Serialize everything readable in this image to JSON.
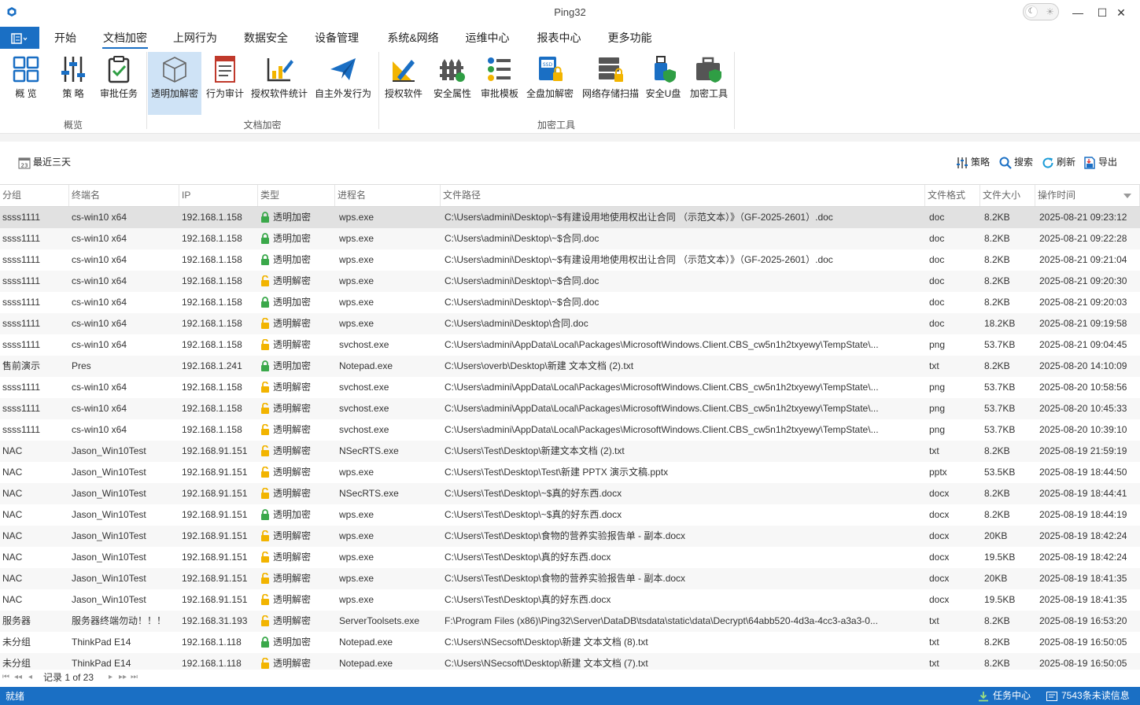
{
  "window": {
    "title": "Ping32",
    "theme_icons": {
      "moon": "☾",
      "sun": "☀"
    },
    "controls": {
      "minimize": "—",
      "maximize": "☐",
      "close": "✕"
    }
  },
  "app_menu_icon": "list-menu-icon",
  "menu_tabs": [
    "开始",
    "文档加密",
    "上网行为",
    "数据安全",
    "设备管理",
    "系统&网络",
    "运维中心",
    "报表中心",
    "更多功能"
  ],
  "active_tab": "文档加密",
  "ribbon": {
    "buttons": [
      {
        "label": "概 览",
        "icon": "dashboard-icon"
      },
      {
        "label": "策 略",
        "icon": "sliders-icon"
      },
      {
        "label": "审批任务",
        "icon": "clipboard-check-icon"
      },
      {
        "label": "透明加解密",
        "icon": "cube-icon",
        "active": true
      },
      {
        "label": "行为审计",
        "icon": "report-icon"
      },
      {
        "label": "授权软件统计",
        "icon": "chart-pen-icon"
      },
      {
        "label": "自主外发行为",
        "icon": "paper-plane-icon"
      },
      {
        "label": "授权软件",
        "icon": "pen-ruler-icon"
      },
      {
        "label": "安全属性",
        "icon": "fence-icon"
      },
      {
        "label": "审批模板",
        "icon": "template-list-icon"
      },
      {
        "label": "全盘加解密",
        "icon": "ssd-lock-icon"
      },
      {
        "label": "网络存储扫描",
        "icon": "server-lock-icon"
      },
      {
        "label": "安全U盘",
        "icon": "usb-shield-icon"
      },
      {
        "label": "加密工具",
        "icon": "toolbox-shield-icon"
      }
    ],
    "groups": [
      "概览",
      "文档加密",
      "加密工具"
    ]
  },
  "toolbar": {
    "date_filter": "最近三天",
    "date_icon_text": "23",
    "policy": "策略",
    "search": "搜索",
    "refresh": "刷新",
    "export": "导出"
  },
  "table": {
    "columns": [
      "分组",
      "终端名",
      "IP",
      "类型",
      "进程名",
      "文件路径",
      "文件格式",
      "文件大小",
      "操作时间"
    ],
    "sort_icon": "sort-desc-icon",
    "rows": [
      {
        "group": "ssss1111",
        "terminal": "cs-win10 x64",
        "ip": "192.168.1.158",
        "type": "透明加密",
        "lock": "green",
        "process": "wps.exe",
        "path": "C:\\Users\\admini\\Desktop\\~$有建设用地使用权出让合同 （示范文本）》（GF-2025-2601）.doc",
        "format": "doc",
        "size": "8.2KB",
        "time": "2025-08-21 09:23:12"
      },
      {
        "group": "ssss1111",
        "terminal": "cs-win10 x64",
        "ip": "192.168.1.158",
        "type": "透明加密",
        "lock": "green",
        "process": "wps.exe",
        "path": "C:\\Users\\admini\\Desktop\\~$合同.doc",
        "format": "doc",
        "size": "8.2KB",
        "time": "2025-08-21 09:22:28"
      },
      {
        "group": "ssss1111",
        "terminal": "cs-win10 x64",
        "ip": "192.168.1.158",
        "type": "透明加密",
        "lock": "green",
        "process": "wps.exe",
        "path": "C:\\Users\\admini\\Desktop\\~$有建设用地使用权出让合同 （示范文本）》（GF-2025-2601）.doc",
        "format": "doc",
        "size": "8.2KB",
        "time": "2025-08-21 09:21:04"
      },
      {
        "group": "ssss1111",
        "terminal": "cs-win10 x64",
        "ip": "192.168.1.158",
        "type": "透明解密",
        "lock": "yellow",
        "process": "wps.exe",
        "path": "C:\\Users\\admini\\Desktop\\~$合同.doc",
        "format": "doc",
        "size": "8.2KB",
        "time": "2025-08-21 09:20:30"
      },
      {
        "group": "ssss1111",
        "terminal": "cs-win10 x64",
        "ip": "192.168.1.158",
        "type": "透明加密",
        "lock": "green",
        "process": "wps.exe",
        "path": "C:\\Users\\admini\\Desktop\\~$合同.doc",
        "format": "doc",
        "size": "8.2KB",
        "time": "2025-08-21 09:20:03"
      },
      {
        "group": "ssss1111",
        "terminal": "cs-win10 x64",
        "ip": "192.168.1.158",
        "type": "透明解密",
        "lock": "yellow",
        "process": "wps.exe",
        "path": "C:\\Users\\admini\\Desktop\\合同.doc",
        "format": "doc",
        "size": "18.2KB",
        "time": "2025-08-21 09:19:58"
      },
      {
        "group": "ssss1111",
        "terminal": "cs-win10 x64",
        "ip": "192.168.1.158",
        "type": "透明解密",
        "lock": "yellow",
        "process": "svchost.exe",
        "path": "C:\\Users\\admini\\AppData\\Local\\Packages\\MicrosoftWindows.Client.CBS_cw5n1h2txyewy\\TempState\\...",
        "format": "png",
        "size": "53.7KB",
        "time": "2025-08-21 09:04:45"
      },
      {
        "group": "售前演示",
        "terminal": "Pres",
        "ip": "192.168.1.241",
        "type": "透明加密",
        "lock": "green",
        "process": "Notepad.exe",
        "path": "C:\\Users\\overb\\Desktop\\新建 文本文档 (2).txt",
        "format": "txt",
        "size": "8.2KB",
        "time": "2025-08-20 14:10:09"
      },
      {
        "group": "ssss1111",
        "terminal": "cs-win10 x64",
        "ip": "192.168.1.158",
        "type": "透明解密",
        "lock": "yellow",
        "process": "svchost.exe",
        "path": "C:\\Users\\admini\\AppData\\Local\\Packages\\MicrosoftWindows.Client.CBS_cw5n1h2txyewy\\TempState\\...",
        "format": "png",
        "size": "53.7KB",
        "time": "2025-08-20 10:58:56"
      },
      {
        "group": "ssss1111",
        "terminal": "cs-win10 x64",
        "ip": "192.168.1.158",
        "type": "透明解密",
        "lock": "yellow",
        "process": "svchost.exe",
        "path": "C:\\Users\\admini\\AppData\\Local\\Packages\\MicrosoftWindows.Client.CBS_cw5n1h2txyewy\\TempState\\...",
        "format": "png",
        "size": "53.7KB",
        "time": "2025-08-20 10:45:33"
      },
      {
        "group": "ssss1111",
        "terminal": "cs-win10 x64",
        "ip": "192.168.1.158",
        "type": "透明解密",
        "lock": "yellow",
        "process": "svchost.exe",
        "path": "C:\\Users\\admini\\AppData\\Local\\Packages\\MicrosoftWindows.Client.CBS_cw5n1h2txyewy\\TempState\\...",
        "format": "png",
        "size": "53.7KB",
        "time": "2025-08-20 10:39:10"
      },
      {
        "group": "NAC",
        "terminal": "Jason_Win10Test",
        "ip": "192.168.91.151",
        "type": "透明解密",
        "lock": "yellow",
        "process": "NSecRTS.exe",
        "path": "C:\\Users\\Test\\Desktop\\新建文本文档 (2).txt",
        "format": "txt",
        "size": "8.2KB",
        "time": "2025-08-19 21:59:19"
      },
      {
        "group": "NAC",
        "terminal": "Jason_Win10Test",
        "ip": "192.168.91.151",
        "type": "透明解密",
        "lock": "yellow",
        "process": "wps.exe",
        "path": "C:\\Users\\Test\\Desktop\\Test\\新建 PPTX 演示文稿.pptx",
        "format": "pptx",
        "size": "53.5KB",
        "time": "2025-08-19 18:44:50"
      },
      {
        "group": "NAC",
        "terminal": "Jason_Win10Test",
        "ip": "192.168.91.151",
        "type": "透明解密",
        "lock": "yellow",
        "process": "NSecRTS.exe",
        "path": "C:\\Users\\Test\\Desktop\\~$真的好东西.docx",
        "format": "docx",
        "size": "8.2KB",
        "time": "2025-08-19 18:44:41"
      },
      {
        "group": "NAC",
        "terminal": "Jason_Win10Test",
        "ip": "192.168.91.151",
        "type": "透明加密",
        "lock": "green",
        "process": "wps.exe",
        "path": "C:\\Users\\Test\\Desktop\\~$真的好东西.docx",
        "format": "docx",
        "size": "8.2KB",
        "time": "2025-08-19 18:44:19"
      },
      {
        "group": "NAC",
        "terminal": "Jason_Win10Test",
        "ip": "192.168.91.151",
        "type": "透明解密",
        "lock": "yellow",
        "process": "wps.exe",
        "path": "C:\\Users\\Test\\Desktop\\食物的营养实验报告单 - 副本.docx",
        "format": "docx",
        "size": "20KB",
        "time": "2025-08-19 18:42:24"
      },
      {
        "group": "NAC",
        "terminal": "Jason_Win10Test",
        "ip": "192.168.91.151",
        "type": "透明解密",
        "lock": "yellow",
        "process": "wps.exe",
        "path": "C:\\Users\\Test\\Desktop\\真的好东西.docx",
        "format": "docx",
        "size": "19.5KB",
        "time": "2025-08-19 18:42:24"
      },
      {
        "group": "NAC",
        "terminal": "Jason_Win10Test",
        "ip": "192.168.91.151",
        "type": "透明解密",
        "lock": "yellow",
        "process": "wps.exe",
        "path": "C:\\Users\\Test\\Desktop\\食物的营养实验报告单 - 副本.docx",
        "format": "docx",
        "size": "20KB",
        "time": "2025-08-19 18:41:35"
      },
      {
        "group": "NAC",
        "terminal": "Jason_Win10Test",
        "ip": "192.168.91.151",
        "type": "透明解密",
        "lock": "yellow",
        "process": "wps.exe",
        "path": "C:\\Users\\Test\\Desktop\\真的好东西.docx",
        "format": "docx",
        "size": "19.5KB",
        "time": "2025-08-19 18:41:35"
      },
      {
        "group": "服务器",
        "terminal": "服务器终端勿动！！！",
        "ip": "192.168.31.193",
        "type": "透明解密",
        "lock": "yellow",
        "process": "ServerToolsets.exe",
        "path": "F:\\Program Files (x86)\\Ping32\\Server\\DataDB\\tsdata\\static\\data\\Decrypt\\64abb520-4d3a-4cc3-a3a3-0...",
        "format": "txt",
        "size": "8.2KB",
        "time": "2025-08-19 16:53:20"
      },
      {
        "group": "未分组",
        "terminal": "ThinkPad E14",
        "ip": "192.168.1.118",
        "type": "透明加密",
        "lock": "green",
        "process": "Notepad.exe",
        "path": "C:\\Users\\NSecsoft\\Desktop\\新建 文本文档 (8).txt",
        "format": "txt",
        "size": "8.2KB",
        "time": "2025-08-19 16:50:05"
      },
      {
        "group": "未分组",
        "terminal": "ThinkPad E14",
        "ip": "192.168.1.118",
        "type": "透明解密",
        "lock": "yellow",
        "process": "Notepad.exe",
        "path": "C:\\Users\\NSecsoft\\Desktop\\新建 文本文档 (7).txt",
        "format": "txt",
        "size": "8.2KB",
        "time": "2025-08-19 16:50:05"
      }
    ]
  },
  "pager": {
    "text": "记录 1 of 23",
    "first": "⏮",
    "prev_page": "◂◂",
    "prev": "◂",
    "next": "▸",
    "next_page": "▸▸",
    "last": "⏭"
  },
  "status": {
    "text": "就绪",
    "task_center": "任务中心",
    "unread": "7543条未读信息"
  },
  "colors": {
    "accent": "#1a6fc4",
    "lock_green": "#3aa84a",
    "lock_yellow": "#f2b400",
    "selected_row": "#e1e1e1"
  }
}
